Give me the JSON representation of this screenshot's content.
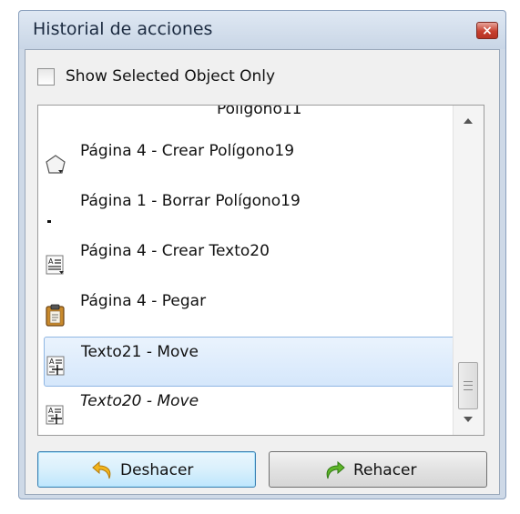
{
  "window": {
    "title": "Historial de acciones",
    "close_glyph": "×"
  },
  "checkbox": {
    "label": "Show Selected Object Only",
    "checked": false
  },
  "history_list": {
    "partial_top_label": "Polígono11",
    "items": [
      {
        "label": "Página 4 - Crear Polígono19",
        "icon": "polygon-icon",
        "selected": false,
        "italic": false
      },
      {
        "label": "Página 1 - Borrar Polígono19",
        "icon": "delete-dash-icon",
        "selected": false,
        "italic": false
      },
      {
        "label": "Página 4 - Crear Texto20",
        "icon": "text-create-icon",
        "selected": false,
        "italic": false
      },
      {
        "label": "Página 4 - Pegar",
        "icon": "clipboard-paste-icon",
        "selected": false,
        "italic": false
      },
      {
        "label": "Texto21 - Move",
        "icon": "text-move-icon",
        "selected": true,
        "italic": false
      },
      {
        "label": "Texto20 - Move",
        "icon": "text-move-icon",
        "selected": false,
        "italic": true
      }
    ]
  },
  "buttons": {
    "undo_label": "Deshacer",
    "redo_label": "Rehacer"
  },
  "colors": {
    "selection": "#d5e7fb",
    "window_frame": "#ced9e7",
    "undo_arrow": "#f2b51c",
    "redo_arrow": "#5fb52a"
  }
}
